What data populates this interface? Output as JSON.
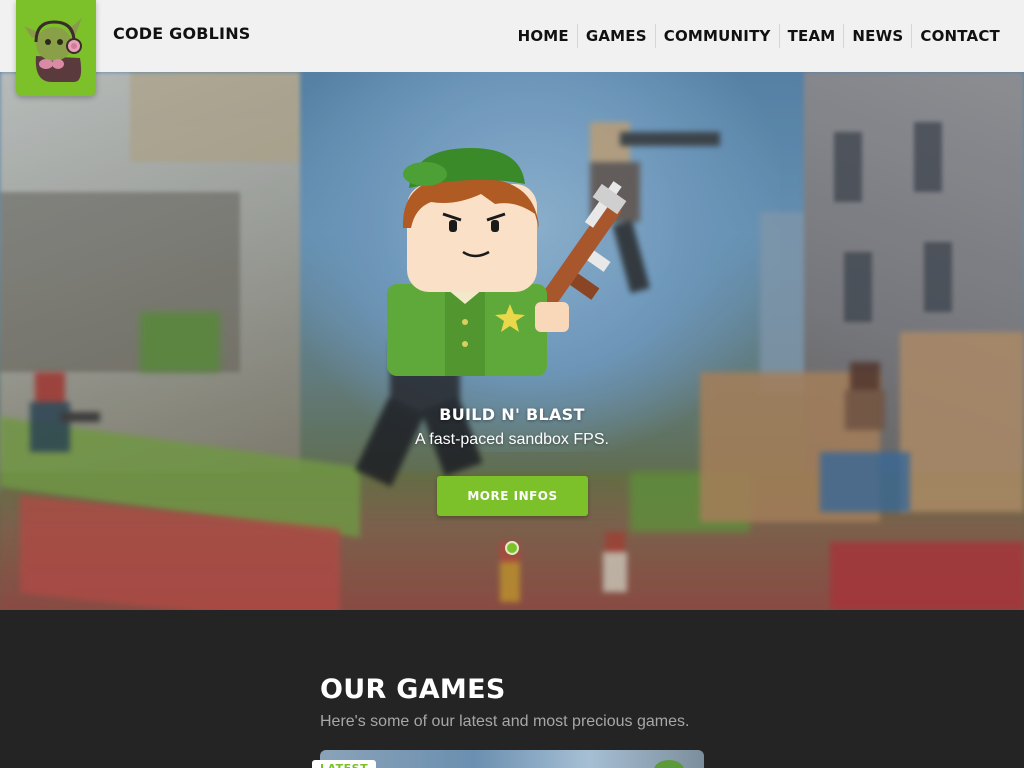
{
  "header": {
    "brand": "CODE GOBLINS",
    "logo_icon": "goblin-mascot-icon",
    "nav": [
      "HOME",
      "GAMES",
      "COMMUNITY",
      "TEAM",
      "NEWS",
      "CONTACT"
    ]
  },
  "hero": {
    "title": "BUILD N' BLAST",
    "description": "A fast-paced sandbox FPS.",
    "button_label": "MORE INFOS",
    "slide_indicator_count": 1,
    "active_slide": 1
  },
  "games": {
    "title": "OUR GAMES",
    "subtitle": "Here's some of our latest and most precious games.",
    "first_card_badge": "LATEST"
  },
  "colors": {
    "accent": "#7cc12a",
    "header_bg": "#f1f1f1",
    "section_bg": "#242424"
  }
}
